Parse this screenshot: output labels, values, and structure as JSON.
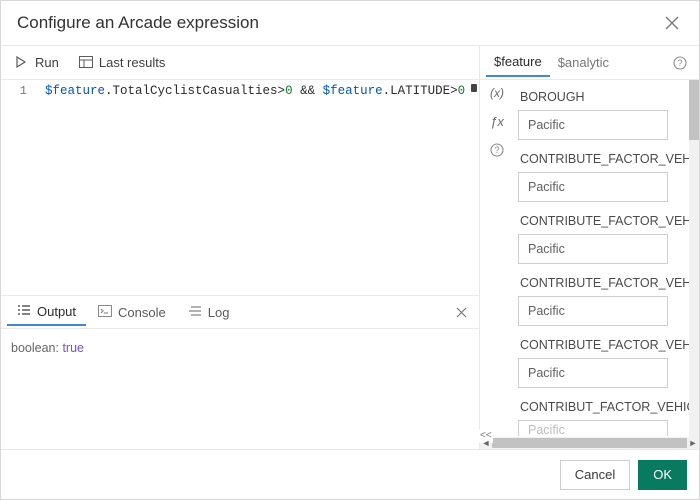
{
  "header": {
    "title": "Configure an Arcade expression"
  },
  "toolbar": {
    "run_label": "Run",
    "last_results_label": "Last results"
  },
  "editor": {
    "line_number": "1",
    "tokens": {
      "var1": "$feature",
      "prop1": ".TotalCyclistCasualties",
      "op1": ">",
      "lit1": "0",
      "logic": " && ",
      "var2": "$feature",
      "prop2": ".LATITUDE",
      "op2": ">",
      "lit2": "0"
    }
  },
  "output_tabs": {
    "output": "Output",
    "console": "Console",
    "log": "Log"
  },
  "output": {
    "type_label": "boolean: ",
    "value": "true"
  },
  "right_tabs": {
    "feature": "$feature",
    "analytic": "$analytic"
  },
  "fields": [
    {
      "label": "BOROUGH",
      "value": "Pacific"
    },
    {
      "label": "CONTRIBUTE_FACTOR_VEHICLE",
      "value": "Pacific"
    },
    {
      "label": "CONTRIBUTE_FACTOR_VEHICLE",
      "value": "Pacific"
    },
    {
      "label": "CONTRIBUTE_FACTOR_VEHICLE",
      "value": "Pacific"
    },
    {
      "label": "CONTRIBUTE_FACTOR_VEHICLE",
      "value": "Pacific"
    },
    {
      "label": "CONTRIBUT_FACTOR_VEHICLE_",
      "value": "Pacific"
    }
  ],
  "footer": {
    "cancel": "Cancel",
    "ok": "OK"
  },
  "icons": {
    "globals_var": "(x)",
    "functions": "ƒx",
    "help": "?"
  }
}
